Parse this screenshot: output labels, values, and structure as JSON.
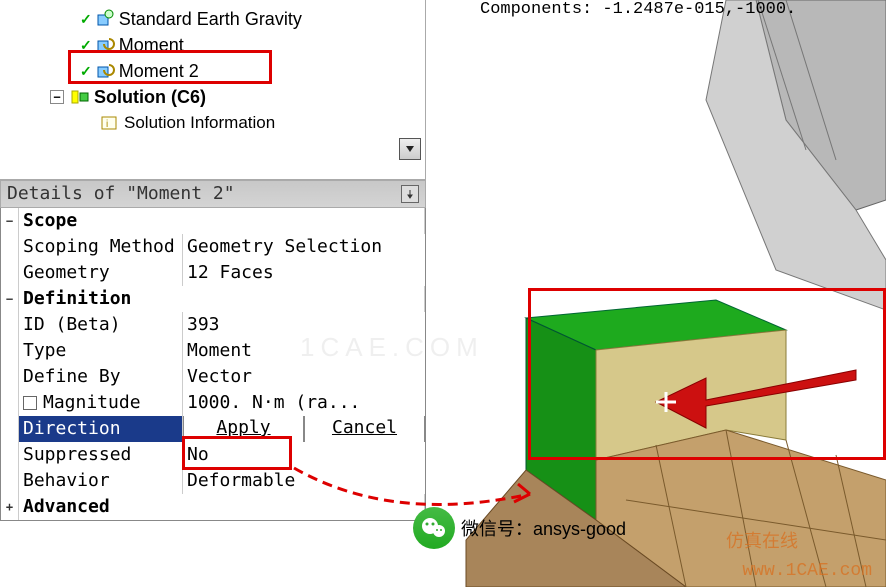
{
  "components_line": "Components: -1.2487e-015,-1000.",
  "tree": {
    "items": [
      {
        "label": "Standard Earth Gravity",
        "icon": "load-cube"
      },
      {
        "label": "Moment",
        "icon": "moment"
      },
      {
        "label": "Moment 2",
        "icon": "moment"
      }
    ],
    "solution": {
      "label": "Solution (C6)"
    },
    "solinfo": {
      "label": "Solution Information"
    }
  },
  "panel_title": "Details of \"Moment 2\"",
  "details": {
    "scope": {
      "header": "Scope",
      "scoping_method": {
        "label": "Scoping Method",
        "value": "Geometry Selection"
      },
      "geometry": {
        "label": "Geometry",
        "value": "12 Faces"
      }
    },
    "definition": {
      "header": "Definition",
      "id": {
        "label": "ID (Beta)",
        "value": "393"
      },
      "type": {
        "label": "Type",
        "value": "Moment"
      },
      "define_by": {
        "label": "Define By",
        "value": "Vector"
      },
      "magnitude": {
        "label": "Magnitude",
        "value": "1000. N·m (ra..."
      },
      "direction": {
        "label": "Direction",
        "apply": "Apply",
        "cancel": "Cancel"
      },
      "suppressed": {
        "label": "Suppressed",
        "value": "No"
      },
      "behavior": {
        "label": "Behavior",
        "value": "Deformable"
      }
    },
    "advanced": {
      "header": "Advanced"
    }
  },
  "wechat": {
    "label": "微信号：",
    "value": "ansys-good"
  },
  "watermark": {
    "cn": "仿真在线",
    "url": "www.1CAE.com",
    "center": "1CAE.COM"
  }
}
